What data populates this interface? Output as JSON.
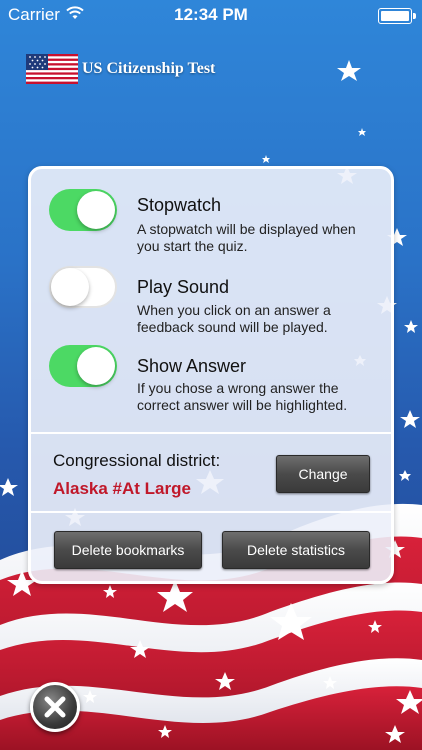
{
  "status_bar": {
    "carrier": "Carrier",
    "time": "12:34 PM",
    "wifi_icon": "wifi-icon",
    "battery_icon": "battery-icon"
  },
  "header": {
    "title": "US Citizenship Test",
    "logo_icon": "us-flag-icon"
  },
  "settings": [
    {
      "title": "Stopwatch",
      "description": "A stopwatch will be displayed when you start the quiz.",
      "enabled": true
    },
    {
      "title": "Play Sound",
      "description": "When you click on an answer a feedback sound will be played.",
      "enabled": false
    },
    {
      "title": "Show Answer",
      "description": "If you chose a wrong answer the correct answer will be highlighted.",
      "enabled": true
    }
  ],
  "district": {
    "label": "Congressional district:",
    "value": "Alaska #At Large",
    "change_label": "Change"
  },
  "actions": {
    "delete_bookmarks_label": "Delete bookmarks",
    "delete_statistics_label": "Delete statistics"
  },
  "close_icon": "close-icon",
  "colors": {
    "toggle_on": "#4cd964",
    "district_value": "#c0182a",
    "background_blue": "#2a72c7"
  }
}
